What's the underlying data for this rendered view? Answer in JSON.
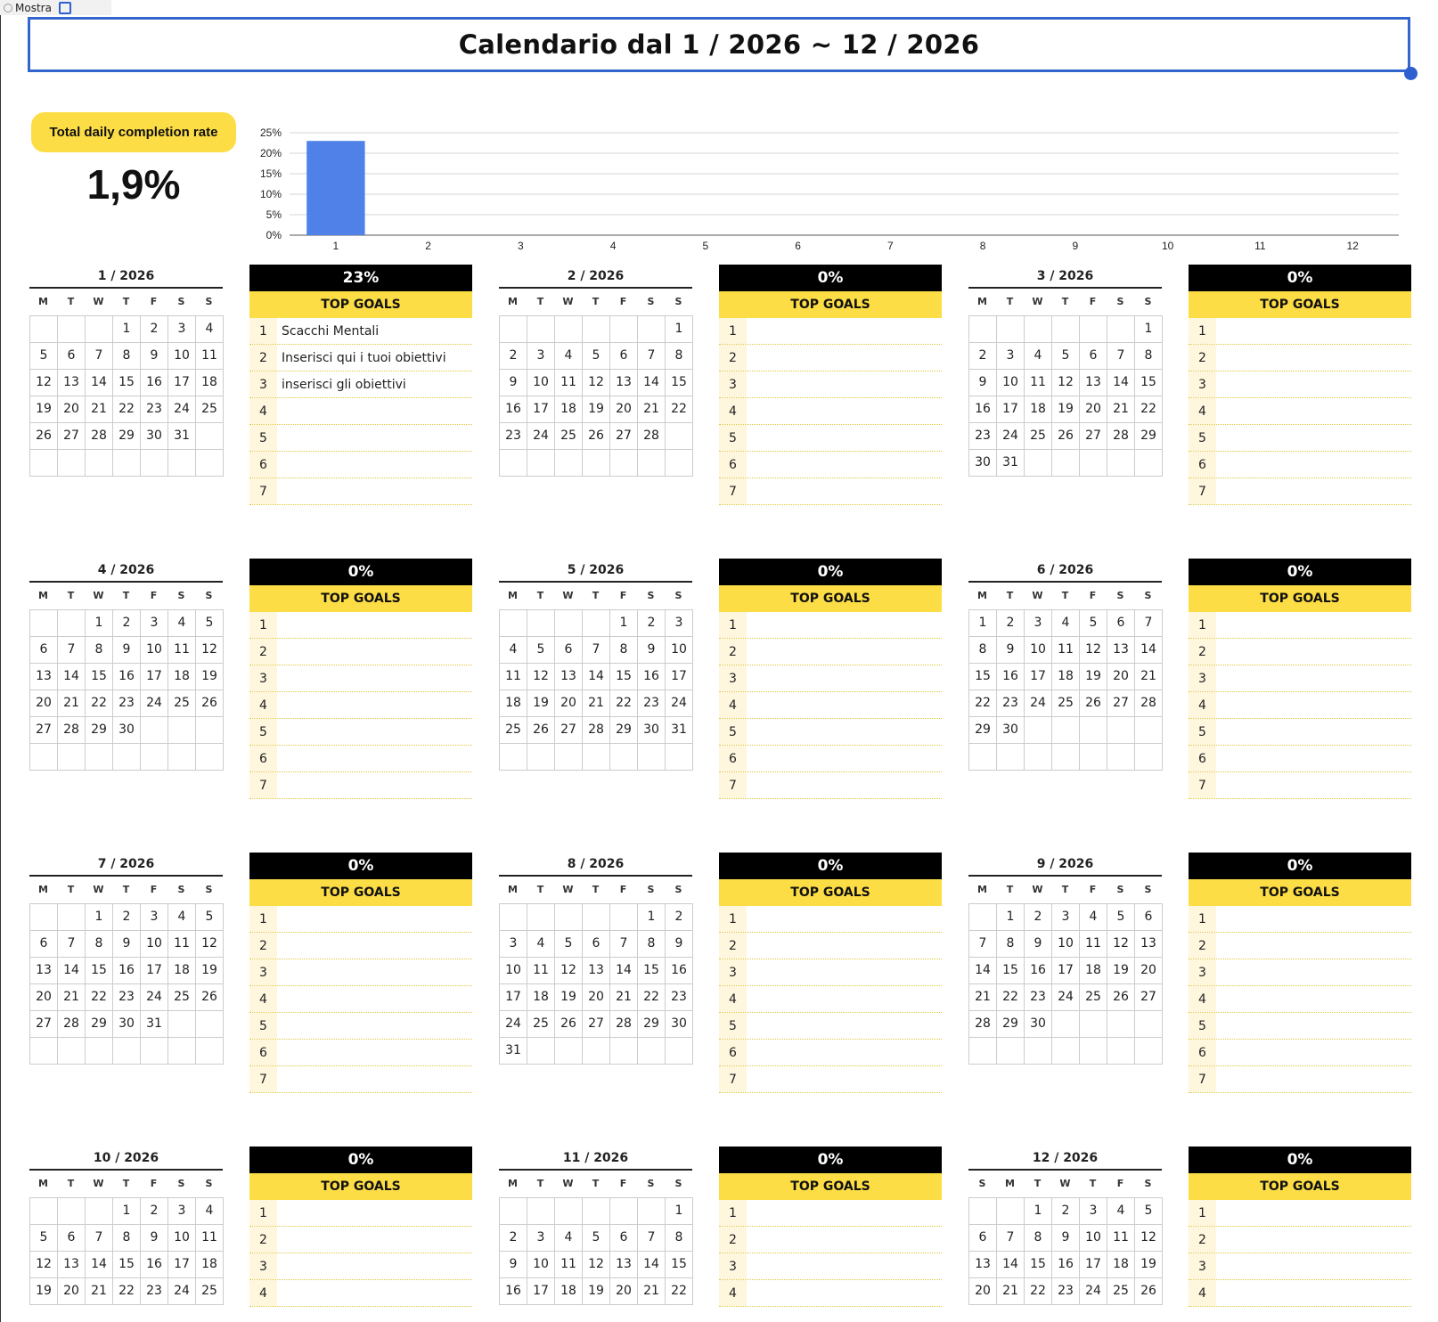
{
  "toolbar": {
    "show_label": "Mostra"
  },
  "header": {
    "title": "Calendario dal  1 / 2026  ~  12 / 2026"
  },
  "summary": {
    "label": "Total daily completion rate",
    "value": "1,9%"
  },
  "chart_data": {
    "type": "bar",
    "categories": [
      "1",
      "2",
      "3",
      "4",
      "5",
      "6",
      "7",
      "8",
      "9",
      "10",
      "11",
      "12"
    ],
    "values": [
      23,
      0,
      0,
      0,
      0,
      0,
      0,
      0,
      0,
      0,
      0,
      0
    ],
    "ylim": [
      0,
      25
    ],
    "yticks": [
      "0%",
      "5%",
      "10%",
      "15%",
      "20%",
      "25%"
    ],
    "grid": true,
    "bar_color": "#4f81e8"
  },
  "goals_label": "TOP GOALS",
  "months": [
    {
      "title": "1 / 2026",
      "weekdays": [
        "M",
        "T",
        "W",
        "T",
        "F",
        "S",
        "S"
      ],
      "pct": "23%",
      "cells": [
        "",
        "",
        "",
        "1",
        "2",
        "3",
        "4",
        "5",
        "6",
        "7",
        "8",
        "9",
        "10",
        "11",
        "12",
        "13",
        "14",
        "15",
        "16",
        "17",
        "18",
        "19",
        "20",
        "21",
        "22",
        "23",
        "24",
        "25",
        "26",
        "27",
        "28",
        "29",
        "30",
        "31",
        "",
        "",
        "",
        "",
        "",
        "",
        "",
        ""
      ],
      "goals": [
        "Scacchi Mentali",
        "Inserisci qui i tuoi obiettivi",
        "inserisci gli obiettivi",
        "",
        "",
        "",
        ""
      ]
    },
    {
      "title": "2 / 2026",
      "weekdays": [
        "M",
        "T",
        "W",
        "T",
        "F",
        "S",
        "S"
      ],
      "pct": "0%",
      "cells": [
        "",
        "",
        "",
        "",
        "",
        "",
        "1",
        "2",
        "3",
        "4",
        "5",
        "6",
        "7",
        "8",
        "9",
        "10",
        "11",
        "12",
        "13",
        "14",
        "15",
        "16",
        "17",
        "18",
        "19",
        "20",
        "21",
        "22",
        "23",
        "24",
        "25",
        "26",
        "27",
        "28",
        "",
        "",
        "",
        "",
        "",
        "",
        "",
        ""
      ],
      "goals": [
        "",
        "",
        "",
        "",
        "",
        "",
        ""
      ]
    },
    {
      "title": "3 / 2026",
      "weekdays": [
        "M",
        "T",
        "W",
        "T",
        "F",
        "S",
        "S"
      ],
      "pct": "0%",
      "cells": [
        "",
        "",
        "",
        "",
        "",
        "",
        "1",
        "2",
        "3",
        "4",
        "5",
        "6",
        "7",
        "8",
        "9",
        "10",
        "11",
        "12",
        "13",
        "14",
        "15",
        "16",
        "17",
        "18",
        "19",
        "20",
        "21",
        "22",
        "23",
        "24",
        "25",
        "26",
        "27",
        "28",
        "29",
        "30",
        "31",
        "",
        "",
        "",
        "",
        ""
      ],
      "goals": [
        "",
        "",
        "",
        "",
        "",
        "",
        ""
      ]
    },
    {
      "title": "4 / 2026",
      "weekdays": [
        "M",
        "T",
        "W",
        "T",
        "F",
        "S",
        "S"
      ],
      "pct": "0%",
      "cells": [
        "",
        "",
        "1",
        "2",
        "3",
        "4",
        "5",
        "6",
        "7",
        "8",
        "9",
        "10",
        "11",
        "12",
        "13",
        "14",
        "15",
        "16",
        "17",
        "18",
        "19",
        "20",
        "21",
        "22",
        "23",
        "24",
        "25",
        "26",
        "27",
        "28",
        "29",
        "30",
        "",
        "",
        "",
        "",
        "",
        "",
        "",
        "",
        "",
        ""
      ],
      "goals": [
        "",
        "",
        "",
        "",
        "",
        "",
        ""
      ]
    },
    {
      "title": "5 / 2026",
      "weekdays": [
        "M",
        "T",
        "W",
        "T",
        "F",
        "S",
        "S"
      ],
      "pct": "0%",
      "cells": [
        "",
        "",
        "",
        "",
        "1",
        "2",
        "3",
        "4",
        "5",
        "6",
        "7",
        "8",
        "9",
        "10",
        "11",
        "12",
        "13",
        "14",
        "15",
        "16",
        "17",
        "18",
        "19",
        "20",
        "21",
        "22",
        "23",
        "24",
        "25",
        "26",
        "27",
        "28",
        "29",
        "30",
        "31",
        "",
        "",
        "",
        "",
        "",
        "",
        ""
      ],
      "goals": [
        "",
        "",
        "",
        "",
        "",
        "",
        ""
      ]
    },
    {
      "title": "6 / 2026",
      "weekdays": [
        "M",
        "T",
        "W",
        "T",
        "F",
        "S",
        "S"
      ],
      "pct": "0%",
      "cells": [
        "1",
        "2",
        "3",
        "4",
        "5",
        "6",
        "7",
        "8",
        "9",
        "10",
        "11",
        "12",
        "13",
        "14",
        "15",
        "16",
        "17",
        "18",
        "19",
        "20",
        "21",
        "22",
        "23",
        "24",
        "25",
        "26",
        "27",
        "28",
        "29",
        "30",
        "",
        "",
        "",
        "",
        "",
        "",
        "",
        "",
        "",
        "",
        "",
        ""
      ],
      "goals": [
        "",
        "",
        "",
        "",
        "",
        "",
        ""
      ]
    },
    {
      "title": "7 / 2026",
      "weekdays": [
        "M",
        "T",
        "W",
        "T",
        "F",
        "S",
        "S"
      ],
      "pct": "0%",
      "cells": [
        "",
        "",
        "1",
        "2",
        "3",
        "4",
        "5",
        "6",
        "7",
        "8",
        "9",
        "10",
        "11",
        "12",
        "13",
        "14",
        "15",
        "16",
        "17",
        "18",
        "19",
        "20",
        "21",
        "22",
        "23",
        "24",
        "25",
        "26",
        "27",
        "28",
        "29",
        "30",
        "31",
        "",
        "",
        "",
        "",
        "",
        "",
        "",
        "",
        ""
      ],
      "goals": [
        "",
        "",
        "",
        "",
        "",
        "",
        ""
      ]
    },
    {
      "title": "8 / 2026",
      "weekdays": [
        "M",
        "T",
        "W",
        "T",
        "F",
        "S",
        "S"
      ],
      "pct": "0%",
      "cells": [
        "",
        "",
        "",
        "",
        "",
        "1",
        "2",
        "3",
        "4",
        "5",
        "6",
        "7",
        "8",
        "9",
        "10",
        "11",
        "12",
        "13",
        "14",
        "15",
        "16",
        "17",
        "18",
        "19",
        "20",
        "21",
        "22",
        "23",
        "24",
        "25",
        "26",
        "27",
        "28",
        "29",
        "30",
        "31",
        "",
        "",
        "",
        "",
        "",
        ""
      ],
      "goals": [
        "",
        "",
        "",
        "",
        "",
        "",
        ""
      ]
    },
    {
      "title": "9 / 2026",
      "weekdays": [
        "M",
        "T",
        "W",
        "T",
        "F",
        "S",
        "S"
      ],
      "pct": "0%",
      "cells": [
        "",
        "1",
        "2",
        "3",
        "4",
        "5",
        "6",
        "7",
        "8",
        "9",
        "10",
        "11",
        "12",
        "13",
        "14",
        "15",
        "16",
        "17",
        "18",
        "19",
        "20",
        "21",
        "22",
        "23",
        "24",
        "25",
        "26",
        "27",
        "28",
        "29",
        "30",
        "",
        "",
        "",
        "",
        "",
        "",
        "",
        "",
        "",
        "",
        ""
      ],
      "goals": [
        "",
        "",
        "",
        "",
        "",
        "",
        ""
      ]
    },
    {
      "title": "10 / 2026",
      "weekdays": [
        "M",
        "T",
        "W",
        "T",
        "F",
        "S",
        "S"
      ],
      "pct": "0%",
      "cells": [
        "",
        "",
        "",
        "1",
        "2",
        "3",
        "4",
        "5",
        "6",
        "7",
        "8",
        "9",
        "10",
        "11",
        "12",
        "13",
        "14",
        "15",
        "16",
        "17",
        "18",
        "19",
        "20",
        "21",
        "22",
        "23",
        "24",
        "25"
      ],
      "goals": [
        "",
        "",
        "",
        ""
      ]
    },
    {
      "title": "11 / 2026",
      "weekdays": [
        "M",
        "T",
        "W",
        "T",
        "F",
        "S",
        "S"
      ],
      "pct": "0%",
      "cells": [
        "",
        "",
        "",
        "",
        "",
        "",
        "1",
        "2",
        "3",
        "4",
        "5",
        "6",
        "7",
        "8",
        "9",
        "10",
        "11",
        "12",
        "13",
        "14",
        "15",
        "16",
        "17",
        "18",
        "19",
        "20",
        "21",
        "22"
      ],
      "goals": [
        "",
        "",
        "",
        ""
      ]
    },
    {
      "title": "12 / 2026",
      "weekdays": [
        "S",
        "M",
        "T",
        "W",
        "T",
        "F",
        "S"
      ],
      "pct": "0%",
      "cells": [
        "",
        "",
        "1",
        "2",
        "3",
        "4",
        "5",
        "6",
        "7",
        "8",
        "9",
        "10",
        "11",
        "12",
        "13",
        "14",
        "15",
        "16",
        "17",
        "18",
        "19",
        "20",
        "21",
        "22",
        "23",
        "24",
        "25",
        "26"
      ],
      "goals": [
        "",
        "",
        "",
        ""
      ]
    }
  ]
}
